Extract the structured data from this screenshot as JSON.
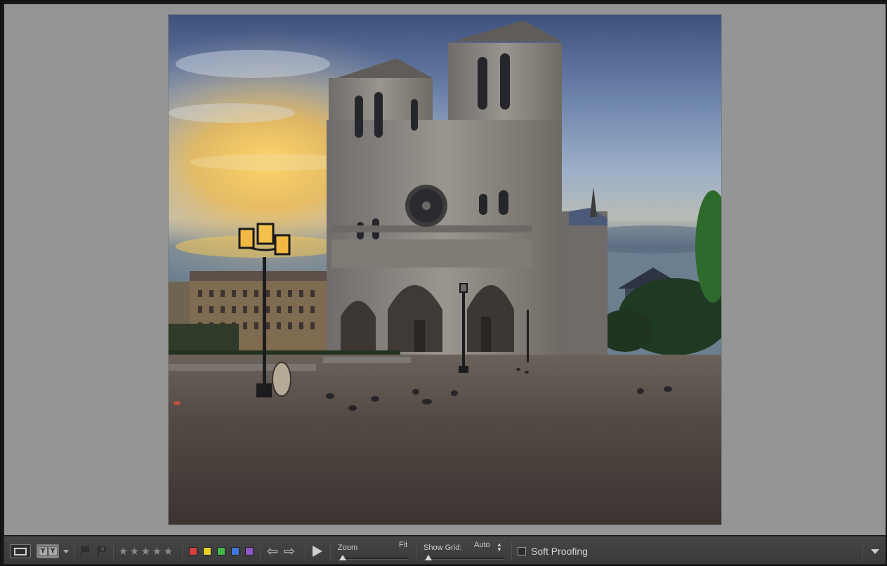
{
  "photo": {
    "subject": "Notre-Dame cathedral at sunrise with pigeons on the square",
    "colors": {
      "sky_top": "#44557f",
      "sky_mid": "#7f96b6",
      "glow": "#f2c24a",
      "stone": "#8b8680",
      "ground": "#4d4541"
    }
  },
  "toolbar": {
    "view_mode_icon": "loupe-view-icon",
    "compare_label": "Y|Y",
    "flag_icons": [
      "pick-flag-icon",
      "reject-flag-icon"
    ],
    "stars": [
      "★",
      "★",
      "★",
      "★",
      "★"
    ],
    "color_labels": [
      "#d9403f",
      "#e3d128",
      "#42b649",
      "#3f78d8",
      "#9254c9"
    ],
    "prev_arrow": "⇦",
    "next_arrow": "⇨",
    "play_icon": "play-icon",
    "zoom": {
      "label": "Zoom",
      "value": "Fit"
    },
    "grid": {
      "label": "Show Grid:",
      "value": "Auto",
      "stepper": "▲▼"
    },
    "soft_proofing": {
      "label": "Soft Proofing",
      "checked": false
    },
    "menu_icon": "toolbar-menu-icon"
  }
}
